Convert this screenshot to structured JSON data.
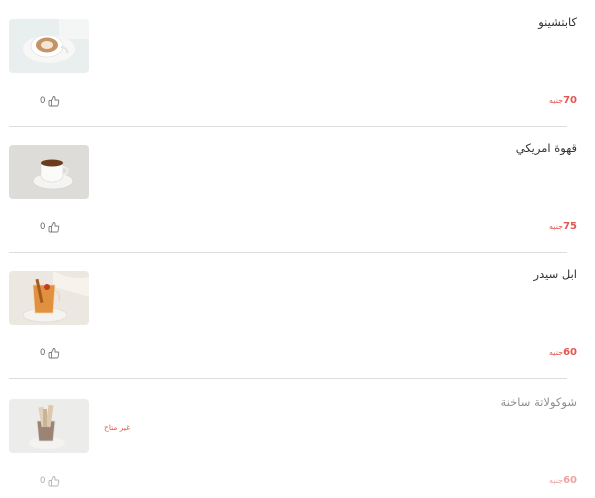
{
  "menu": {
    "items": [
      {
        "name": "كابتشينو",
        "price": "70",
        "currency": "جنيه",
        "likes": "0",
        "image": "cappuccino-cup"
      },
      {
        "name": "قهوة امريكي",
        "price": "75",
        "currency": "جنيه",
        "likes": "0",
        "image": "espresso-cup"
      },
      {
        "name": "ابل سيدر",
        "price": "60",
        "currency": "جنيه",
        "likes": "0",
        "image": "apple-cider-glass"
      },
      {
        "name": "شوكولاتة ساخنة",
        "price": "60",
        "currency": "جنيه",
        "likes": "0",
        "image": "hot-chocolate-wafers",
        "status": "غير متاح"
      }
    ]
  },
  "icons": {
    "like": "thumbs-up-icon"
  },
  "colors": {
    "price": "#e0574f",
    "text": "#333333",
    "divider": "#dddddd"
  }
}
